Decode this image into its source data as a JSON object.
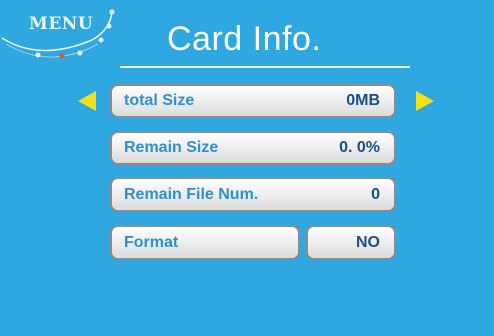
{
  "menu": {
    "label": "MENU"
  },
  "header": {
    "title": "Card Info."
  },
  "rows": [
    {
      "label": "total Size",
      "value": "0MB"
    },
    {
      "label": "Remain Size",
      "value": "0. 0%"
    },
    {
      "label": "Remain File Num.",
      "value": "0"
    },
    {
      "label": "Format",
      "value": "NO"
    }
  ],
  "icons": {
    "prev": "triangle-left-icon",
    "next": "triangle-right-icon",
    "menu_decoration": "dotted-arc-icon"
  },
  "colors": {
    "background": "#2fa7e0",
    "arrow": "#f2e11a",
    "label_text": "#2f8fd0",
    "value_text": "#1a4e8a",
    "accent_dot": "#e8523a"
  }
}
